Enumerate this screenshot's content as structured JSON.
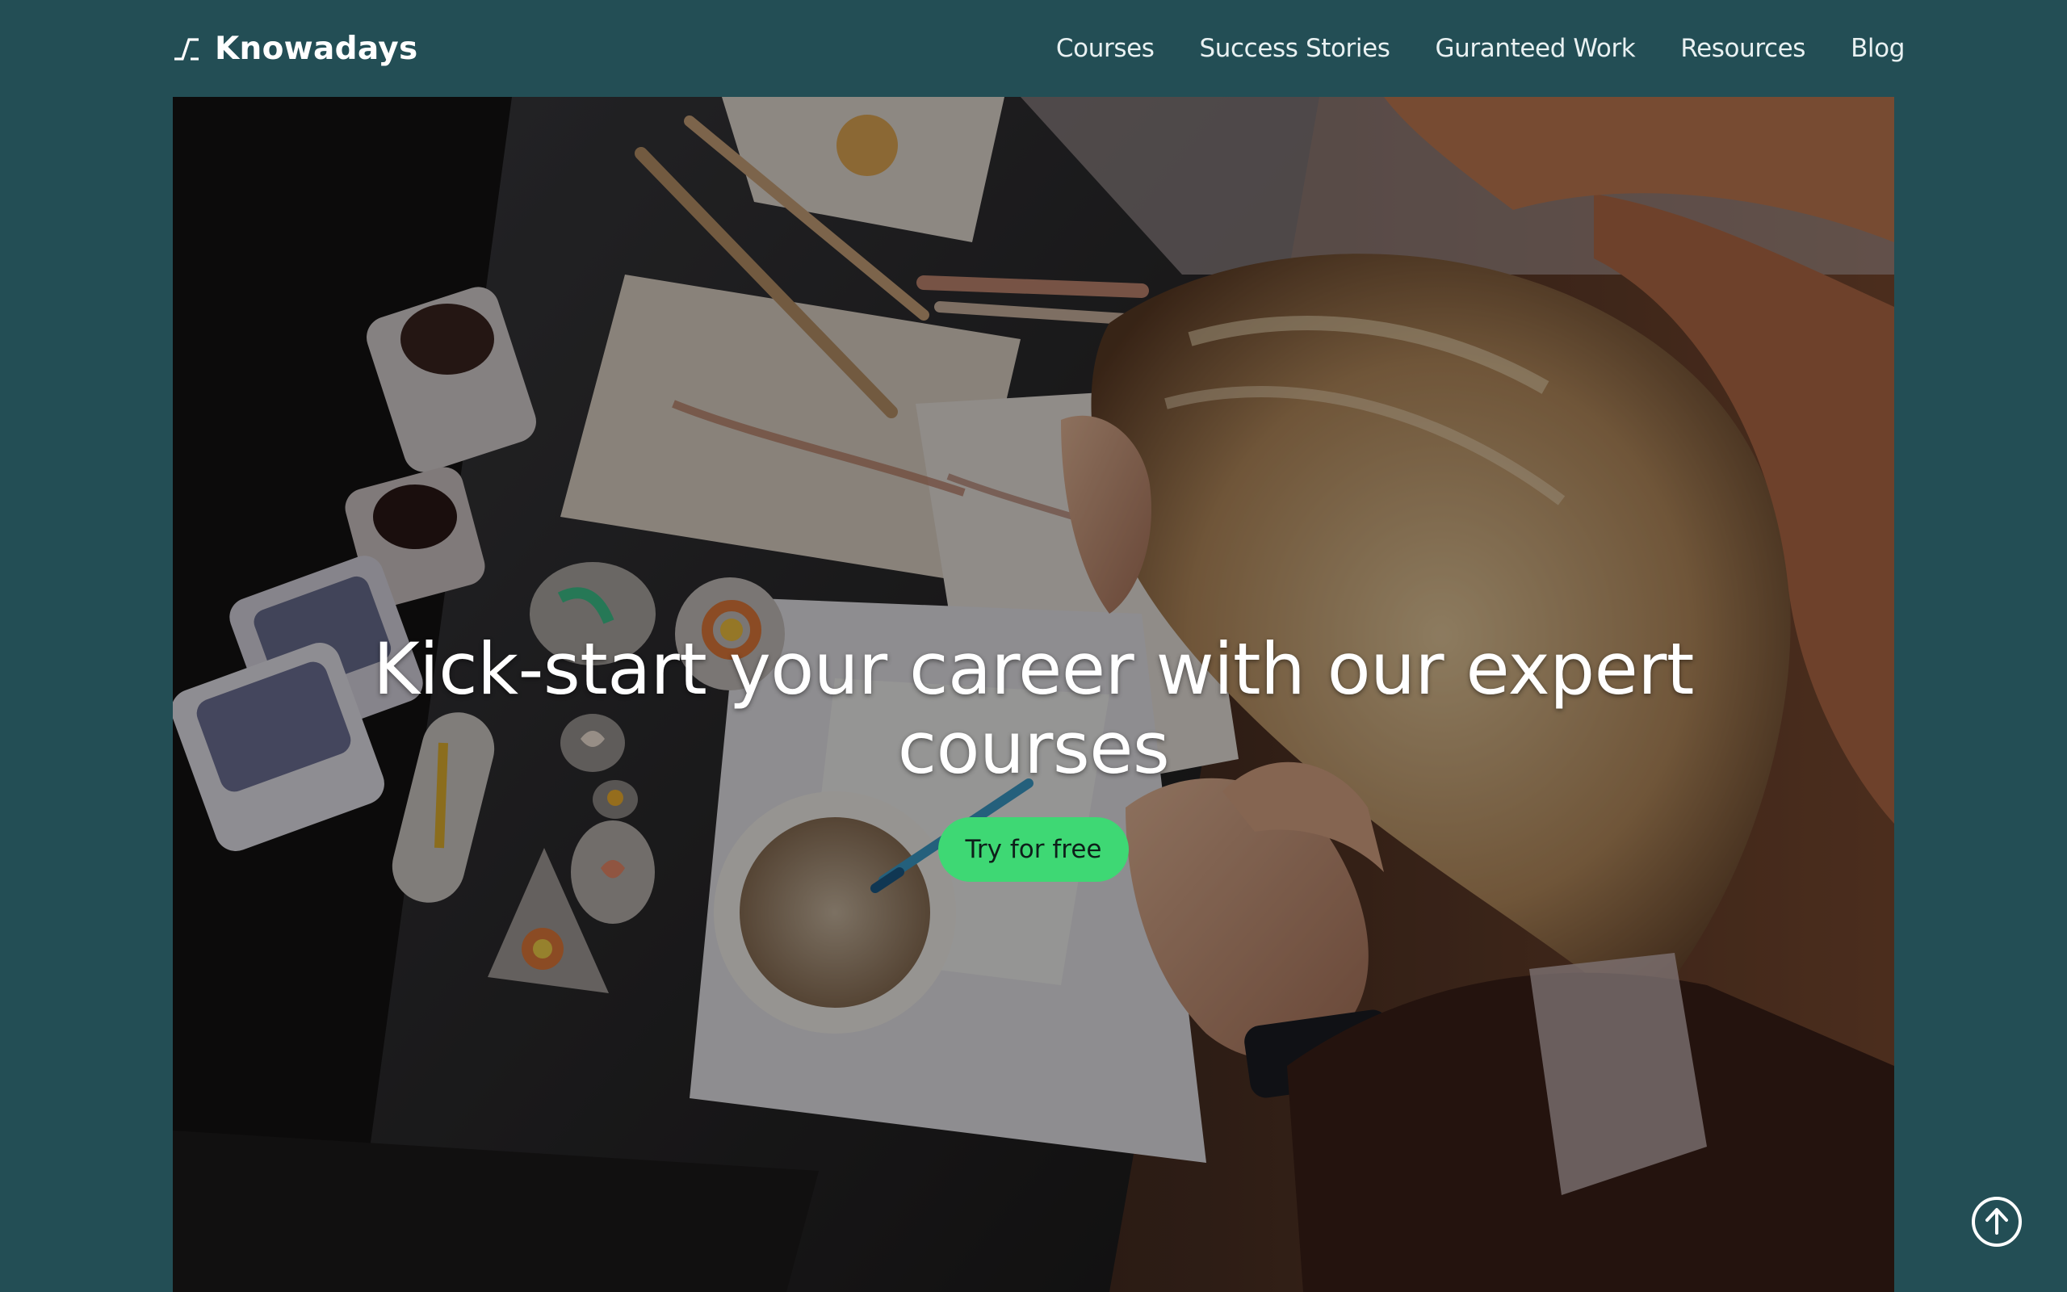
{
  "brand": {
    "name": "Knowadays",
    "logo_icon": "step-line-icon"
  },
  "nav": {
    "links": [
      {
        "label": "Courses"
      },
      {
        "label": "Success Stories"
      },
      {
        "label": "Guranteed Work"
      },
      {
        "label": "Resources"
      },
      {
        "label": "Blog"
      }
    ]
  },
  "hero": {
    "title": "Kick-start your career with our expert courses",
    "cta_label": "Try for free",
    "image": "person-painting-stones-at-craft-table"
  },
  "scroll_top": {
    "icon": "arrow-up-circle-icon"
  },
  "colors": {
    "background": "#234e55",
    "accent": "#3ed874",
    "text_light": "#ffffff"
  }
}
